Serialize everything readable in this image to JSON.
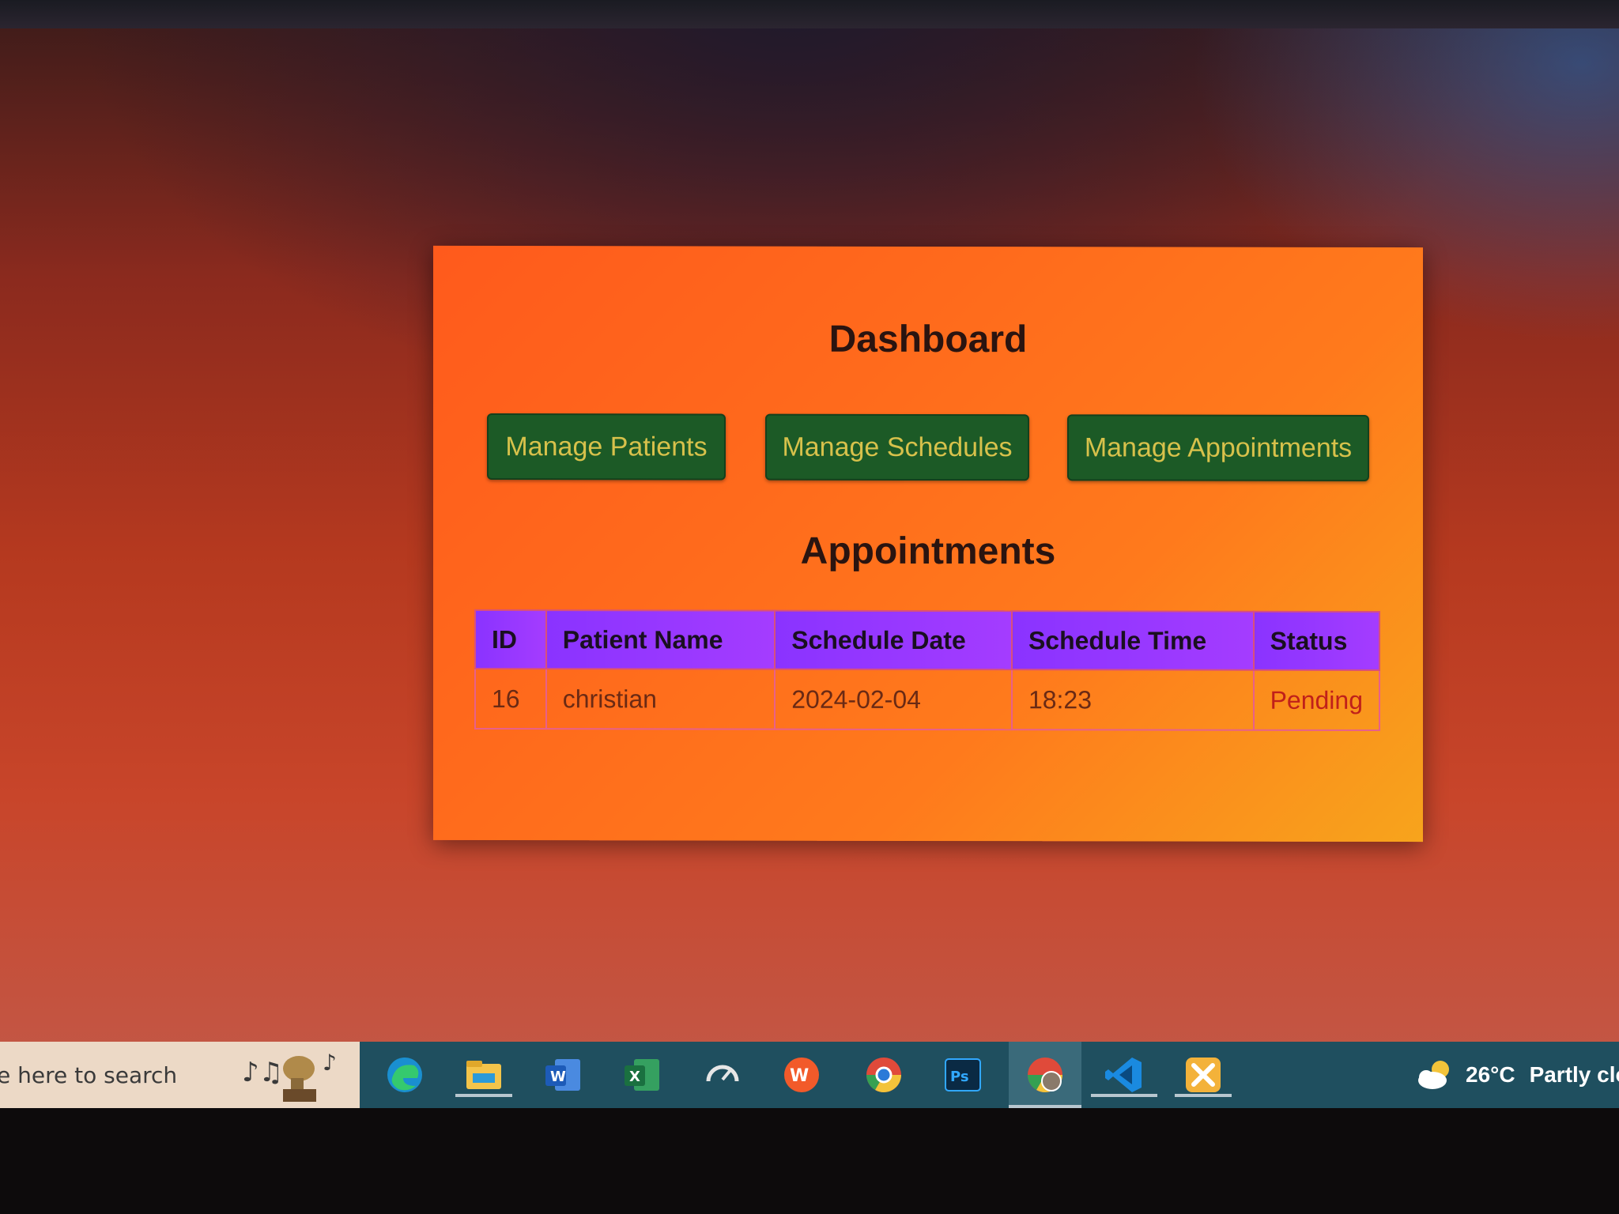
{
  "dashboard": {
    "title": "Dashboard",
    "buttons": {
      "patients": "Manage Patients",
      "schedules": "Manage Schedules",
      "appointments": "Manage Appointments"
    },
    "section_title": "Appointments"
  },
  "table": {
    "headers": [
      "ID",
      "Patient Name",
      "Schedule Date",
      "Schedule Time",
      "Status"
    ],
    "rows": [
      [
        "16",
        "christian",
        "2024-02-04",
        "18:23",
        "Pending"
      ]
    ]
  },
  "taskbar": {
    "search_placeholder": "e here to search",
    "apps": [
      "edge-icon",
      "file-explorer-icon",
      "word-icon",
      "excel-icon",
      "speedometer-icon",
      "wps-office-icon",
      "chrome-icon",
      "photoshop-icon",
      "chrome-profile-icon",
      "vscode-icon",
      "xampp-icon"
    ],
    "weather": {
      "temp": "26°C",
      "condition": "Partly clo"
    }
  },
  "colors": {
    "panel": "#ff6a1c",
    "button_bg": "#1c5a26",
    "button_text": "#d7c14b",
    "table_header": "#9a38ff",
    "status_pending": "#c0201a"
  }
}
